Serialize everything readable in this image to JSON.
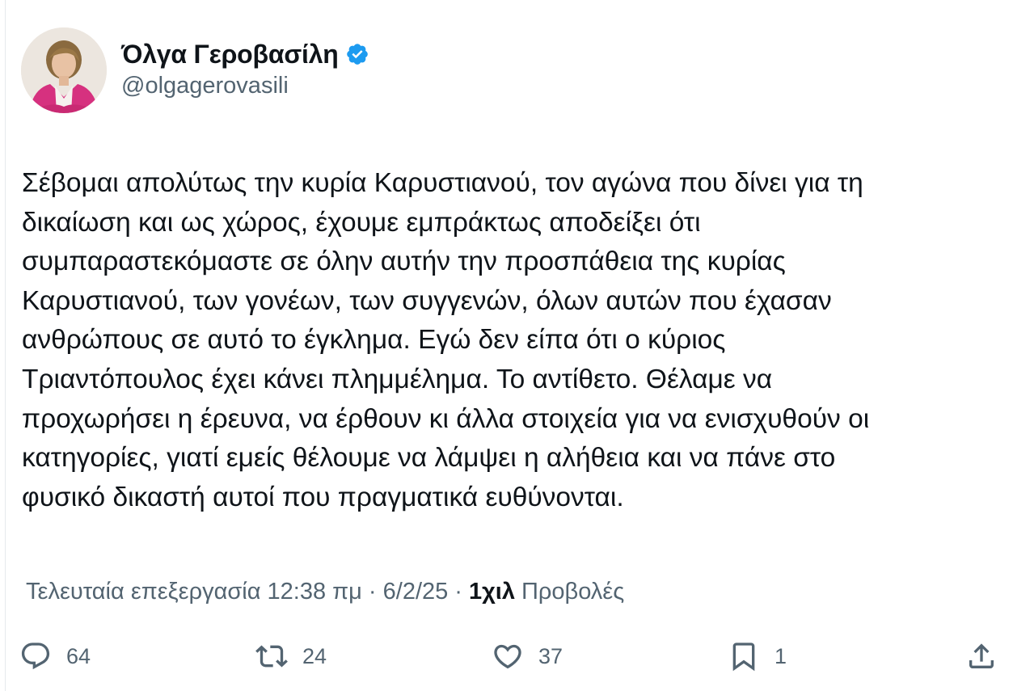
{
  "author": {
    "display_name": "Όλγα Γεροβασίλη",
    "handle": "@olgagerovasili",
    "verified": true,
    "avatar_icon": "profile-photo"
  },
  "tweet": {
    "text_lines": [
      "Σέβομαι απολύτως την κυρία Καρυστιανού, τον αγώνα που δίνει για τη",
      "δικαίωση και ως χώρος, έχουμε εμπράκτως αποδείξει ότι",
      "συμπαραστεκόμαστε σε όλην αυτήν την προσπάθεια της κυρίας",
      "Καρυστιανού, των γονέων, των συγγενών, όλων αυτών που έχασαν",
      "ανθρώπους σε αυτό το έγκλημα. Εγώ δεν είπα ότι ο κύριος",
      "Τριαντόπουλος έχει κάνει πλημμέλημα. Το αντίθετο. Θέλαμε να",
      "προχωρήσει η έρευνα, να έρθουν κι άλλα στοιχεία για να ενισχυθούν οι",
      "κατηγορίες, γιατί εμείς θέλουμε να λάμψει η αλήθεια και να πάνε στο",
      "φυσικό δικαστή αυτοί που πραγματικά ευθύνονται."
    ]
  },
  "meta": {
    "edited_label": "Τελευταία επεξεργασία 12:38 πμ · 6/2/25",
    "separator": "·",
    "views_count": "1χιλ",
    "views_label": "Προβολές"
  },
  "actions": {
    "replies": {
      "icon": "reply-icon",
      "count": "64"
    },
    "reposts": {
      "icon": "repost-icon",
      "count": "24"
    },
    "likes": {
      "icon": "like-icon",
      "count": "37"
    },
    "bookmarks": {
      "icon": "bookmark-icon",
      "count": "1"
    },
    "share": {
      "icon": "share-icon"
    }
  },
  "colors": {
    "text_primary": "#0f1419",
    "text_secondary": "#536471",
    "verified_blue": "#1d9bf0",
    "avatar_jacket": "#d6317f"
  }
}
